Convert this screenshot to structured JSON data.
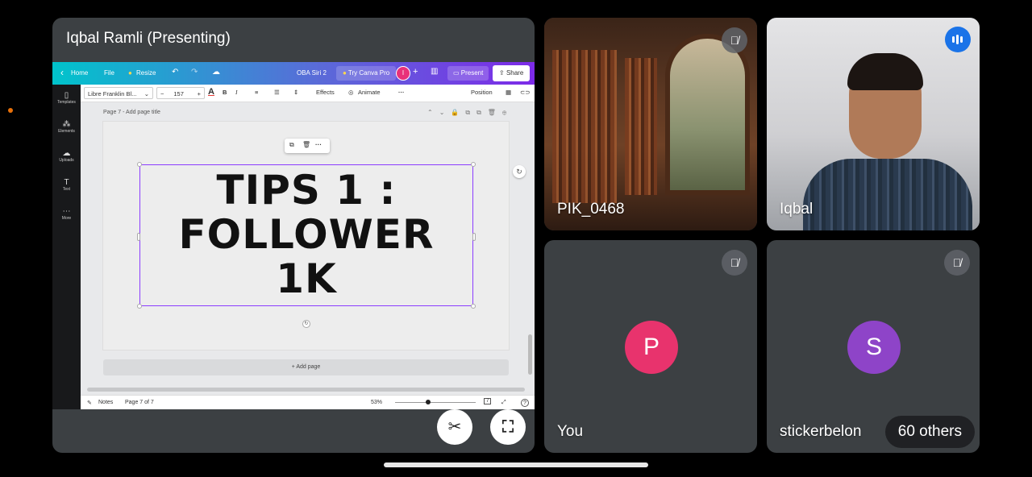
{
  "presenter": {
    "title": "Iqbal Ramli (Presenting)"
  },
  "canva": {
    "topbar": {
      "home": "Home",
      "file": "File",
      "resize": "Resize",
      "doc_name": "OBA Siri 2",
      "try_pro": "Try Canva Pro",
      "avatar_letter": "I",
      "present": "Present",
      "share": "Share"
    },
    "sidebar": [
      {
        "label": "Templates",
        "icon": "templates-icon",
        "glyph": "▯"
      },
      {
        "label": "Elements",
        "icon": "elements-icon",
        "glyph": "⁂"
      },
      {
        "label": "Uploads",
        "icon": "upload-icon",
        "glyph": "☁"
      },
      {
        "label": "Text",
        "icon": "text-icon",
        "glyph": "T"
      },
      {
        "label": "More",
        "icon": "more-icon",
        "glyph": "⋯"
      }
    ],
    "toolbar": {
      "font": "Libre Franklin Bl...",
      "size": "157",
      "effects": "Effects",
      "animate": "Animate",
      "position": "Position"
    },
    "page_label": "Page 7 - Add page title",
    "slide_text": [
      "TIPS 1 :",
      "FOLLOWER",
      "1K"
    ],
    "add_page": "+ Add page",
    "bottom": {
      "notes": "Notes",
      "page_indicator": "Page 7 of 7",
      "zoom": "53%",
      "page_count_badge": "7"
    }
  },
  "controls": {
    "unpin_icon": "unpin-icon",
    "fullscreen_icon": "fullscreen-icon"
  },
  "participants": [
    {
      "name": "PIK_0468",
      "muted": true
    },
    {
      "name": "Iqbal",
      "speaking": true
    },
    {
      "name": "You",
      "muted": true,
      "avatar_letter": "P",
      "avatar_color": "#e8336d"
    },
    {
      "name": "stickerbelon",
      "muted": true,
      "avatar_letter": "S",
      "avatar_color": "#8e44c8",
      "others_label": "60 others"
    }
  ]
}
